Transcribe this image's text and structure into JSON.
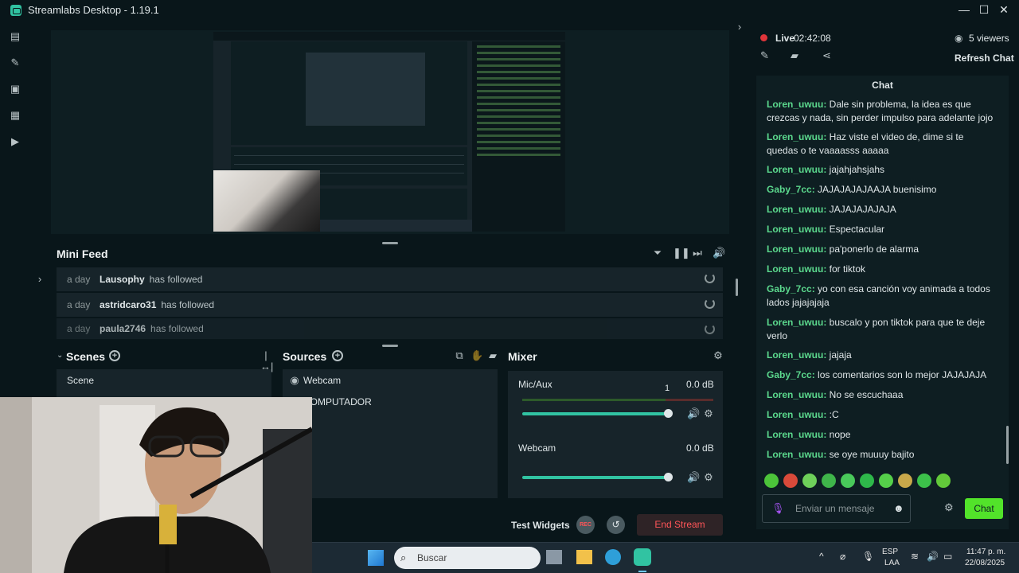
{
  "window": {
    "title": "Streamlabs Desktop - 1.19.1",
    "minimize": "—",
    "maximize": "☐",
    "close": "✕"
  },
  "nav": {
    "icons": [
      "editor-icon",
      "themes-icon",
      "store-icon",
      "layout-icon",
      "play-icon"
    ]
  },
  "preview": {
    "toggle": "›"
  },
  "mini_feed": {
    "title": "Mini Feed",
    "items": [
      {
        "ago": "a day",
        "user": "Lausophy",
        "action": "has followed"
      },
      {
        "ago": "a day",
        "user": "astridcaro31",
        "action": "has followed"
      },
      {
        "ago": "a day",
        "user": "paula2746",
        "action": "has followed"
      }
    ]
  },
  "scenes": {
    "title": "Scenes",
    "items": [
      "Scene"
    ]
  },
  "sources": {
    "title": "Sources",
    "items": [
      "Webcam",
      "COMPUTADOR"
    ]
  },
  "mixer": {
    "title": "Mixer",
    "channels": [
      {
        "name": "Mic/Aux",
        "db": "0.0 dB",
        "level": 1
      },
      {
        "name": "Webcam",
        "db": "0.0 dB",
        "level": 1
      }
    ],
    "marker": "1"
  },
  "footer": {
    "test_widgets": "Test Widgets",
    "rec": "REC",
    "end_stream": "End Stream"
  },
  "stream": {
    "status": "Live",
    "time": "02:42:08",
    "viewers": "5 viewers",
    "refresh": "Refresh Chat"
  },
  "chat": {
    "title": "Chat",
    "messages": [
      {
        "user": "Loren_uwuu:",
        "text": "Dale sin problema, la idea es que crezcas y nada, sin perder impulso para adelante jojo"
      },
      {
        "user": "Loren_uwuu:",
        "text": "Haz viste el video de, dime si te quedas o te vaaaasss aaaaa"
      },
      {
        "user": "Loren_uwuu:",
        "text": "jajahjahsjahs"
      },
      {
        "user": "Gaby_7cc:",
        "text": "JAJAJAJAJAAJA buenisimo"
      },
      {
        "user": "Loren_uwuu:",
        "text": "JAJAJAJAJAJA"
      },
      {
        "user": "Loren_uwuu:",
        "text": "Espectacular"
      },
      {
        "user": "Loren_uwuu:",
        "text": "pa'ponerlo de alarma"
      },
      {
        "user": "Loren_uwuu:",
        "text": "for tiktok"
      },
      {
        "user": "Gaby_7cc:",
        "text": "yo con esa canción voy animada a todos lados jajajajaja"
      },
      {
        "user": "Loren_uwuu:",
        "text": "buscalo y pon tiktok para que te deje verlo"
      },
      {
        "user": "Loren_uwuu:",
        "text": "jajaja"
      },
      {
        "user": "Gaby_7cc:",
        "text": "los comentarios son lo mejor JAJAJAJA"
      },
      {
        "user": "Loren_uwuu:",
        "text": "No se escuchaaa"
      },
      {
        "user": "Loren_uwuu:",
        "text": ":C"
      },
      {
        "user": "Loren_uwuu:",
        "text": "nope"
      },
      {
        "user": "Loren_uwuu:",
        "text": "se oye muuuy bajito"
      }
    ],
    "placeholder": "Enviar un mensaje",
    "send": "Chat"
  },
  "taskbar": {
    "search": "Buscar",
    "lang": "ESP",
    "lang2": "LAA",
    "time": "11:47 p. m.",
    "date": "22/08/2025"
  },
  "colors": {
    "accent": "#31c3a2",
    "live": "#e0353a",
    "end_stream": "#ff5558",
    "chat_send": "#52e32a",
    "username": "#5bd88d"
  }
}
